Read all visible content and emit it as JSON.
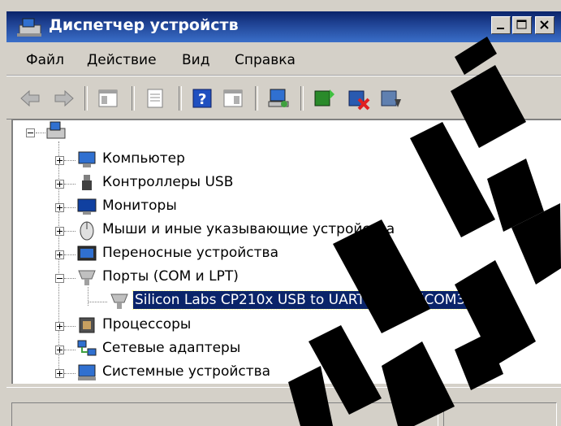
{
  "window": {
    "title": "Диспетчер устройств",
    "minimize": "_",
    "maximize": "□",
    "close": "×"
  },
  "menu": [
    "Файл",
    "Действие",
    "Вид",
    "Справка"
  ],
  "tree": {
    "items": [
      {
        "label": "Компьютер",
        "icon": "computer-icon",
        "expanded": false
      },
      {
        "label": "Контроллеры USB",
        "icon": "usb-icon",
        "expanded": false
      },
      {
        "label": "Мониторы",
        "icon": "monitor-icon",
        "expanded": false
      },
      {
        "label": "Мыши и иные указывающие устройства",
        "icon": "mouse-icon",
        "expanded": false
      },
      {
        "label": "Переносные устройства",
        "icon": "portable-device-icon",
        "expanded": false
      },
      {
        "label": "Порты (COM и LPT)",
        "icon": "port-icon",
        "expanded": true
      },
      {
        "label": "Silicon Labs CP210x USB to UART Bridge (COM3)",
        "icon": "port-icon",
        "selected": true
      },
      {
        "label": "Процессоры",
        "icon": "cpu-icon",
        "expanded": false
      },
      {
        "label": "Сетевые адаптеры",
        "icon": "network-icon",
        "expanded": false
      },
      {
        "label": "Системные устройства",
        "icon": "system-device-icon",
        "expanded": false
      }
    ]
  },
  "colors": {
    "title_bar": "#0a246a",
    "selection": "#0a246a",
    "watermark": "#000000"
  }
}
